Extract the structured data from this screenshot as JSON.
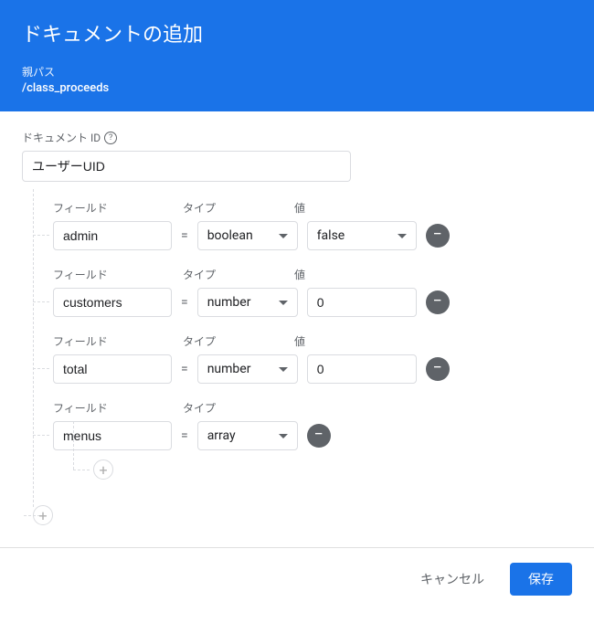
{
  "header": {
    "title": "ドキュメントの追加",
    "parent_label": "親パス",
    "parent_path": "/class_proceeds"
  },
  "doc_id": {
    "label": "ドキュメント ID",
    "value": "ユーザーUID"
  },
  "labels": {
    "field": "フィールド",
    "type": "タイプ",
    "value": "値"
  },
  "fields": [
    {
      "name": "admin",
      "type": "boolean",
      "value": "false",
      "has_value_dropdown": true
    },
    {
      "name": "customers",
      "type": "number",
      "value": "0",
      "has_value_dropdown": false
    },
    {
      "name": "total",
      "type": "number",
      "value": "0",
      "has_value_dropdown": false
    },
    {
      "name": "menus",
      "type": "array",
      "value": null,
      "has_value_dropdown": false
    }
  ],
  "footer": {
    "cancel": "キャンセル",
    "save": "保存"
  }
}
